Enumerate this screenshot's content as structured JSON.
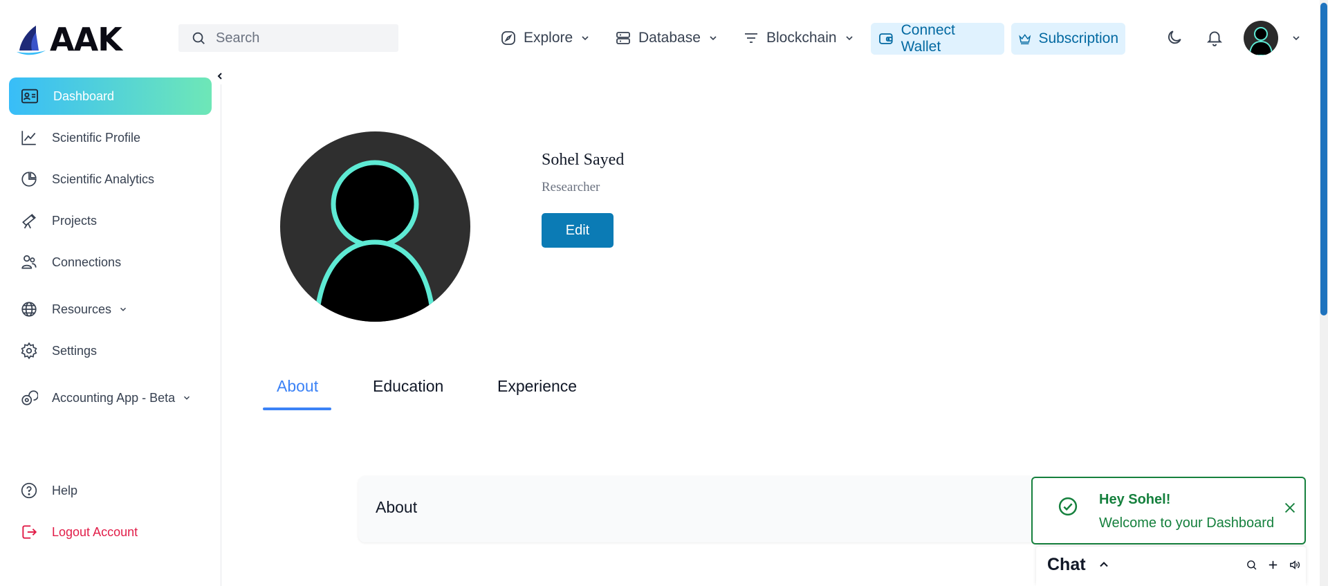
{
  "header": {
    "logo_text": "AAK",
    "search_placeholder": "Search",
    "nav": [
      {
        "label": "Explore",
        "icon": "compass-icon"
      },
      {
        "label": "Database",
        "icon": "server-icon"
      },
      {
        "label": "Blockchain",
        "icon": "filter-icon"
      }
    ],
    "connect_wallet": "Connect Wallet",
    "subscription": "Subscription",
    "icons": [
      "moon-icon",
      "bell-icon",
      "avatar",
      "chevron-down-icon"
    ]
  },
  "sidebar": {
    "items": [
      {
        "label": "Dashboard",
        "icon": "id-card-icon",
        "active": true
      },
      {
        "label": "Scientific Profile",
        "icon": "line-chart-icon"
      },
      {
        "label": "Scientific Analytics",
        "icon": "pie-chart-icon"
      },
      {
        "label": "Projects",
        "icon": "telescope-icon"
      },
      {
        "label": "Connections",
        "icon": "users-icon"
      },
      {
        "label": "Resources",
        "icon": "globe-icon",
        "has_submenu": true
      },
      {
        "label": "Settings",
        "icon": "gear-icon"
      },
      {
        "label": "Accounting App - Beta",
        "icon": "coins-icon",
        "has_submenu": true
      },
      {
        "label": "Help",
        "icon": "help-circle-icon"
      },
      {
        "label": "Logout Account",
        "icon": "logout-icon"
      }
    ]
  },
  "profile": {
    "name": "Sohel Sayed",
    "role": "Researcher",
    "edit_label": "Edit"
  },
  "tabs": [
    {
      "label": "About",
      "active": true
    },
    {
      "label": "Education"
    },
    {
      "label": "Experience"
    }
  ],
  "about_card": {
    "title": "About"
  },
  "toast": {
    "title": "Hey Sohel!",
    "message": "Welcome to your Dashboard"
  },
  "chat": {
    "title": "Chat"
  },
  "colors": {
    "accent": "#0b7bb5",
    "active_tab": "#3b82f6",
    "toast_green": "#15803d",
    "logout_red": "#e11d48",
    "avatar_ring": "#5eead4"
  }
}
